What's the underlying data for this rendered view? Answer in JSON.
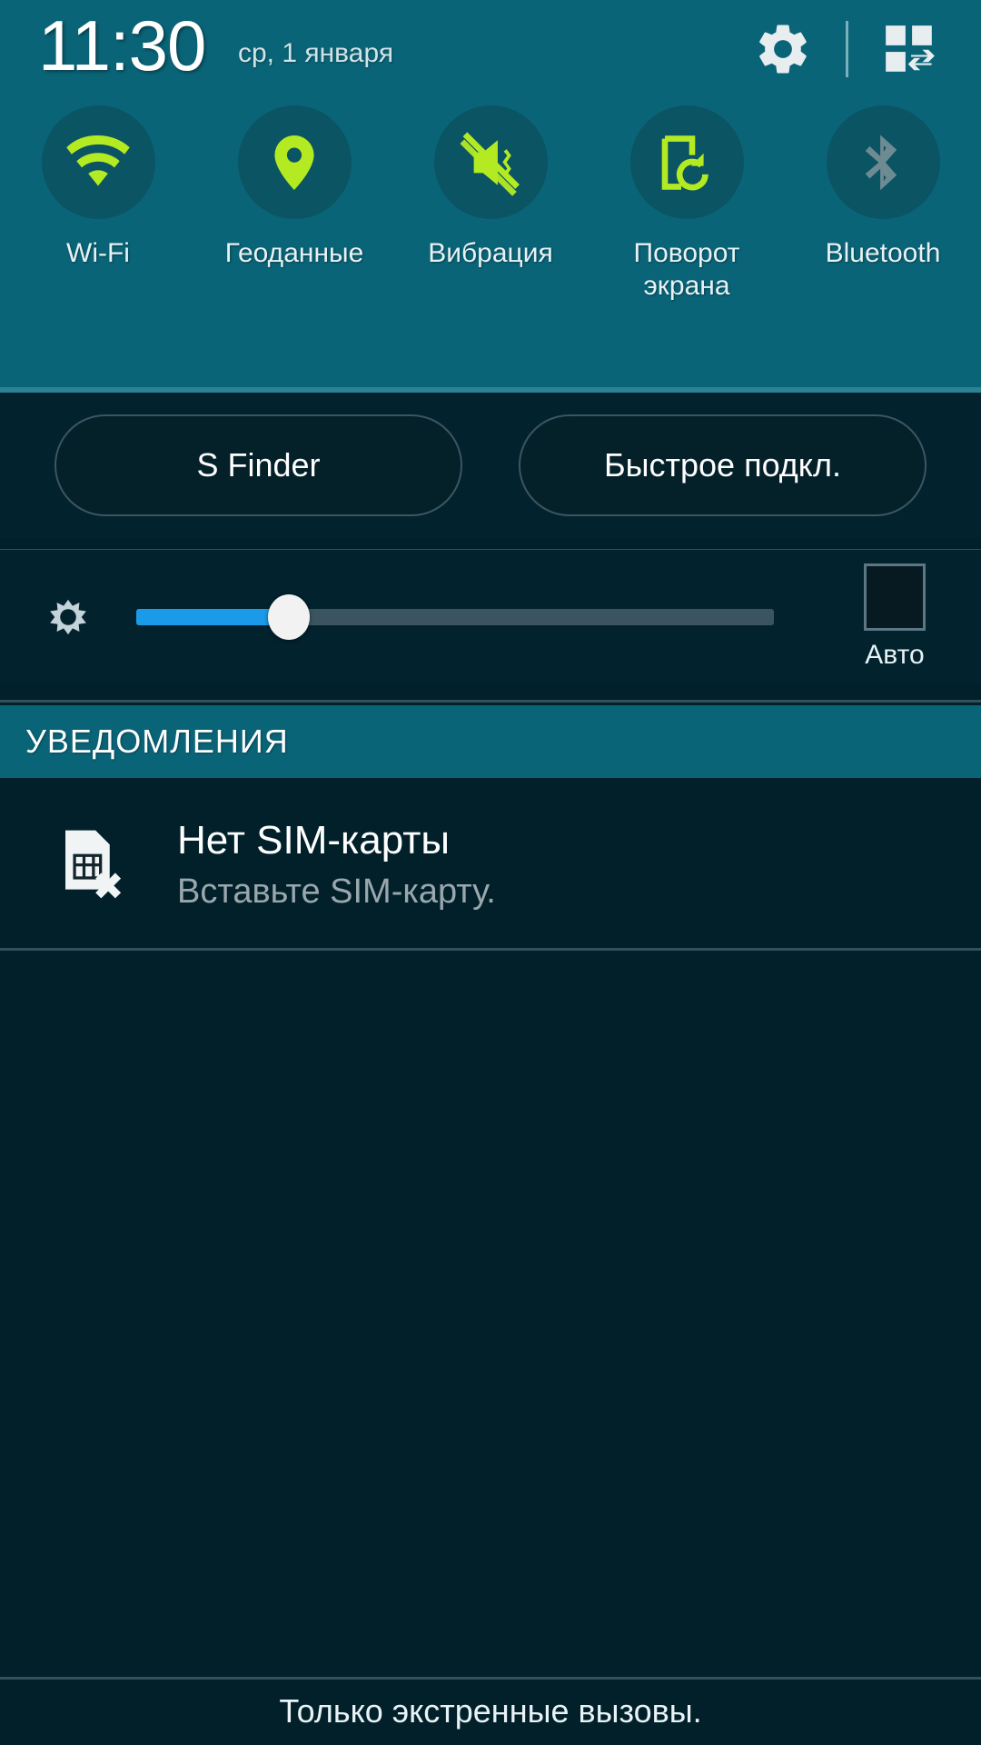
{
  "colors": {
    "teal_panel": "#0a6477",
    "dark_body": "#01202a",
    "toggle_circle": "#0a5464",
    "accent_green": "#b4ea22",
    "inactive_grey": "#6e8a92",
    "slider_blue": "#1a9ae8"
  },
  "status": {
    "time": "11:30",
    "date": "ср, 1 января",
    "settings_icon": "gear-icon",
    "quick_settings_icon": "quick-settings-grid-icon"
  },
  "toggles": [
    {
      "label": "Wi-Fi",
      "icon": "wifi-icon",
      "state": "on"
    },
    {
      "label": "Геоданные",
      "icon": "location-pin-icon",
      "state": "on"
    },
    {
      "label": "Вибрация",
      "icon": "vibrate-mute-icon",
      "state": "on"
    },
    {
      "label": "Поворот\nэкрана",
      "icon": "screen-rotation-icon",
      "state": "on"
    },
    {
      "label": "Bluetooth",
      "icon": "bluetooth-icon",
      "state": "off"
    }
  ],
  "quick_buttons": [
    {
      "label": "S Finder",
      "name": "s-finder-button"
    },
    {
      "label": "Быстрое подкл.",
      "name": "quick-connect-button"
    }
  ],
  "brightness": {
    "icon": "brightness-gear-icon",
    "value_percent": 24,
    "auto_label": "Авто",
    "auto_checked": false
  },
  "notifications": {
    "section_title": "УВЕДОМЛЕНИЯ",
    "items": [
      {
        "icon": "sim-card-missing-icon",
        "title": "Нет SIM-карты",
        "subtitle": "Вставьте SIM-карту."
      }
    ]
  },
  "footer": {
    "text": "Только экстренные вызовы."
  }
}
